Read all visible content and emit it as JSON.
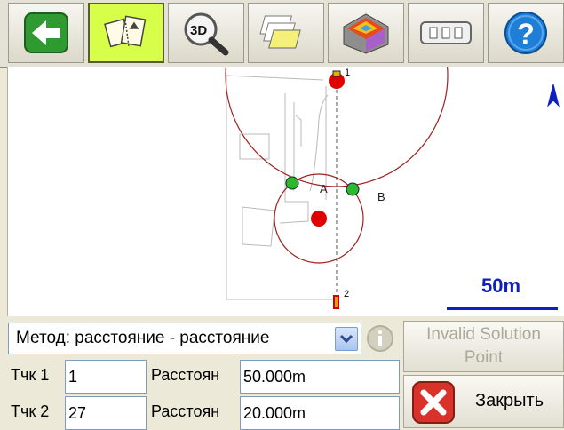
{
  "toolbar": {
    "buttons": [
      {
        "name": "back-button",
        "icon": "back-arrow-icon"
      },
      {
        "name": "intersection-tool-button",
        "icon": "intersection-icon",
        "active": true
      },
      {
        "name": "view-3d-button",
        "icon": "3d-zoom-icon",
        "label": "3D"
      },
      {
        "name": "layers-button",
        "icon": "layers-icon"
      },
      {
        "name": "surface-button",
        "icon": "surface-icon"
      },
      {
        "name": "keyboard-button",
        "icon": "keyboard-icon"
      },
      {
        "name": "help-button",
        "icon": "help-icon",
        "label": "?"
      }
    ]
  },
  "map": {
    "point1_label": "1",
    "point2_label": "2",
    "solution_a": "A",
    "solution_b": "B",
    "scale_label": "50m",
    "north_icon": "north-arrow-icon"
  },
  "form": {
    "method_select": "Метод: расстояние - расстояние",
    "invalid_button": "Invalid Solution Point",
    "point1_label": "Тчк 1",
    "point1_value": "1",
    "point2_label": "Тчк 2",
    "point2_value": "27",
    "distance1_label": "Расстоян",
    "distance1_value": "50.000m",
    "distance2_label": "Расстоян",
    "distance2_value": "20.000m",
    "close_button": "Закрыть"
  },
  "colors": {
    "accent_green": "#d7ff4a",
    "circle": "#a02020",
    "point_red": "#e00000",
    "solution_green": "#2db82d",
    "scale_blue": "#1020c0"
  }
}
